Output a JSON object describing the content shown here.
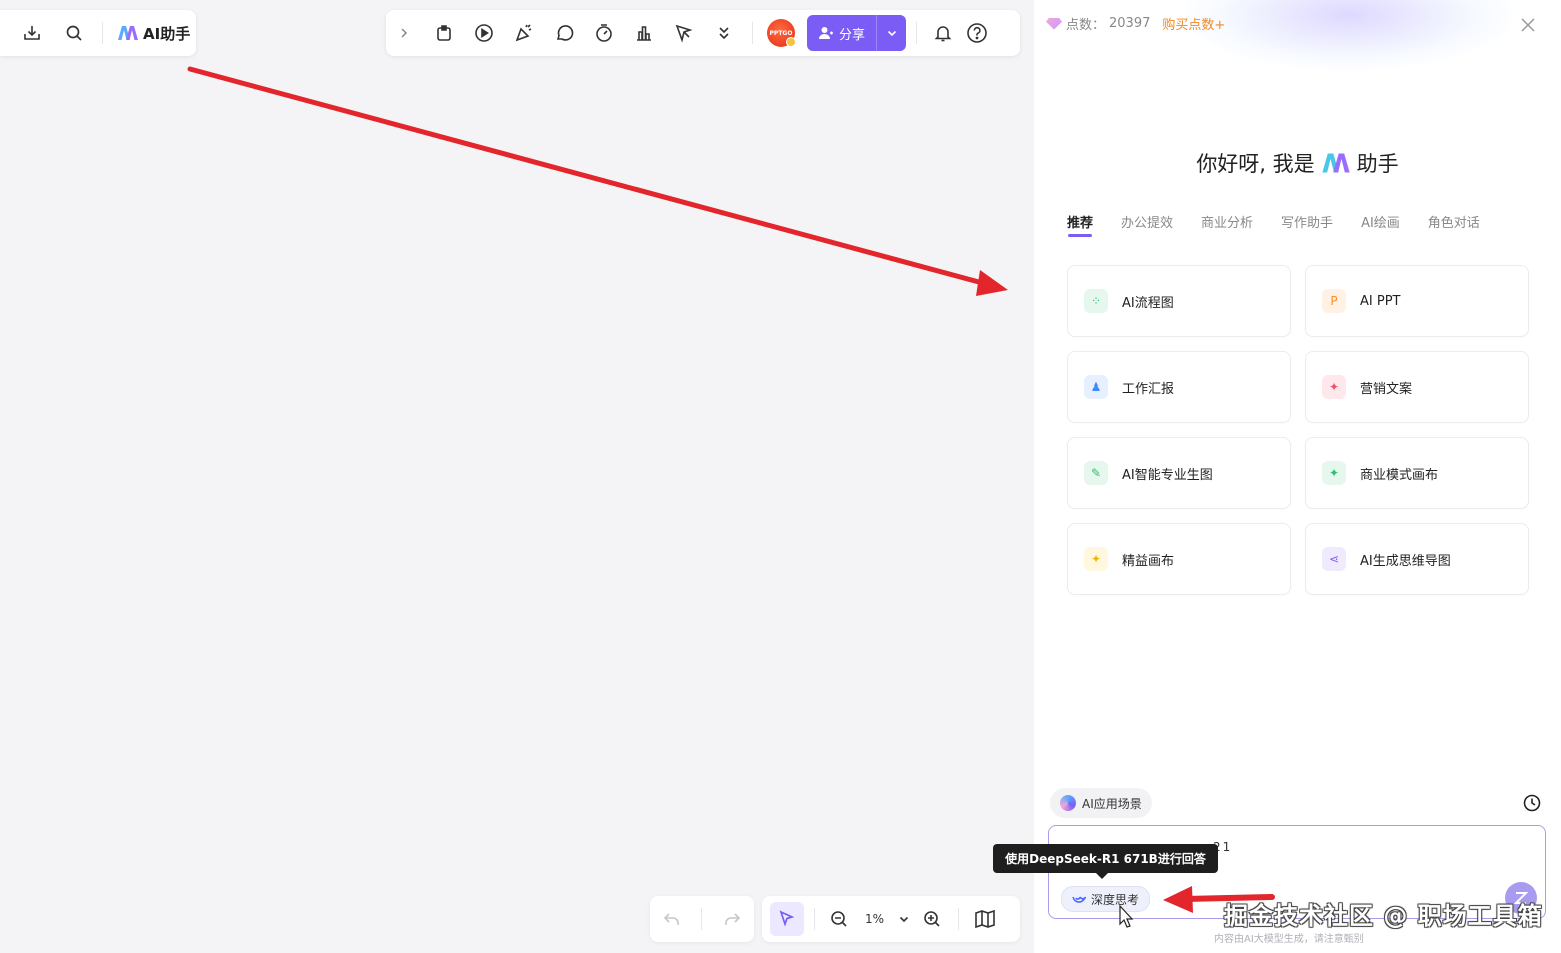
{
  "toolbar_left": {
    "download_icon": "download-icon",
    "search_icon": "search-icon",
    "ai_label": "AI助手"
  },
  "toolbar_top": {
    "avatar_text": "PPTGO",
    "share_label": "分享"
  },
  "zoom": {
    "value": "1%"
  },
  "panel": {
    "points_label": "点数：",
    "points_value": "20397",
    "buy_label": "购买点数",
    "buy_plus": "+",
    "greeting_prefix": "你好呀, 我是",
    "greeting_suffix": "助手",
    "tabs": [
      "推荐",
      "办公提效",
      "商业分析",
      "写作助手",
      "AI绘画",
      "角色对话"
    ],
    "cards": [
      {
        "label": "AI流程图",
        "icon_color": "#2fbf71",
        "icon_bg": "#e6f8ee",
        "icon_glyph": "⁘"
      },
      {
        "label": "AI PPT",
        "icon_color": "#ff8a2a",
        "icon_bg": "#fff1e4",
        "icon_glyph": "P"
      },
      {
        "label": "工作汇报",
        "icon_color": "#3b8bff",
        "icon_bg": "#e7f0ff",
        "icon_glyph": "♟"
      },
      {
        "label": "营销文案",
        "icon_color": "#f0506e",
        "icon_bg": "#ffe8ec",
        "icon_glyph": "✦"
      },
      {
        "label": "AI智能专业生图",
        "icon_color": "#2fbf71",
        "icon_bg": "#e6f8ee",
        "icon_glyph": "✎"
      },
      {
        "label": "商业模式画布",
        "icon_color": "#2fbf71",
        "icon_bg": "#e6f8ee",
        "icon_glyph": "✦"
      },
      {
        "label": "精益画布",
        "icon_color": "#f5b800",
        "icon_bg": "#fff8df",
        "icon_glyph": "✦"
      },
      {
        "label": "AI生成思维导图",
        "icon_color": "#8b5cf6",
        "icon_bg": "#f0eaff",
        "icon_glyph": "⋖"
      }
    ],
    "scene_label": "AI应用场景",
    "input_text": "21",
    "deep_think_label": "深度思考",
    "disclaimer": "内容由AI大模型生成，请注意甄别",
    "watermark": "掘金技术社区 @ 职场工具箱"
  },
  "tooltip": {
    "text": "使用DeepSeek-R1 671B进行回答"
  },
  "colors": {
    "accent": "#7b5cf5",
    "annotation_arrow": "#e3262b"
  }
}
